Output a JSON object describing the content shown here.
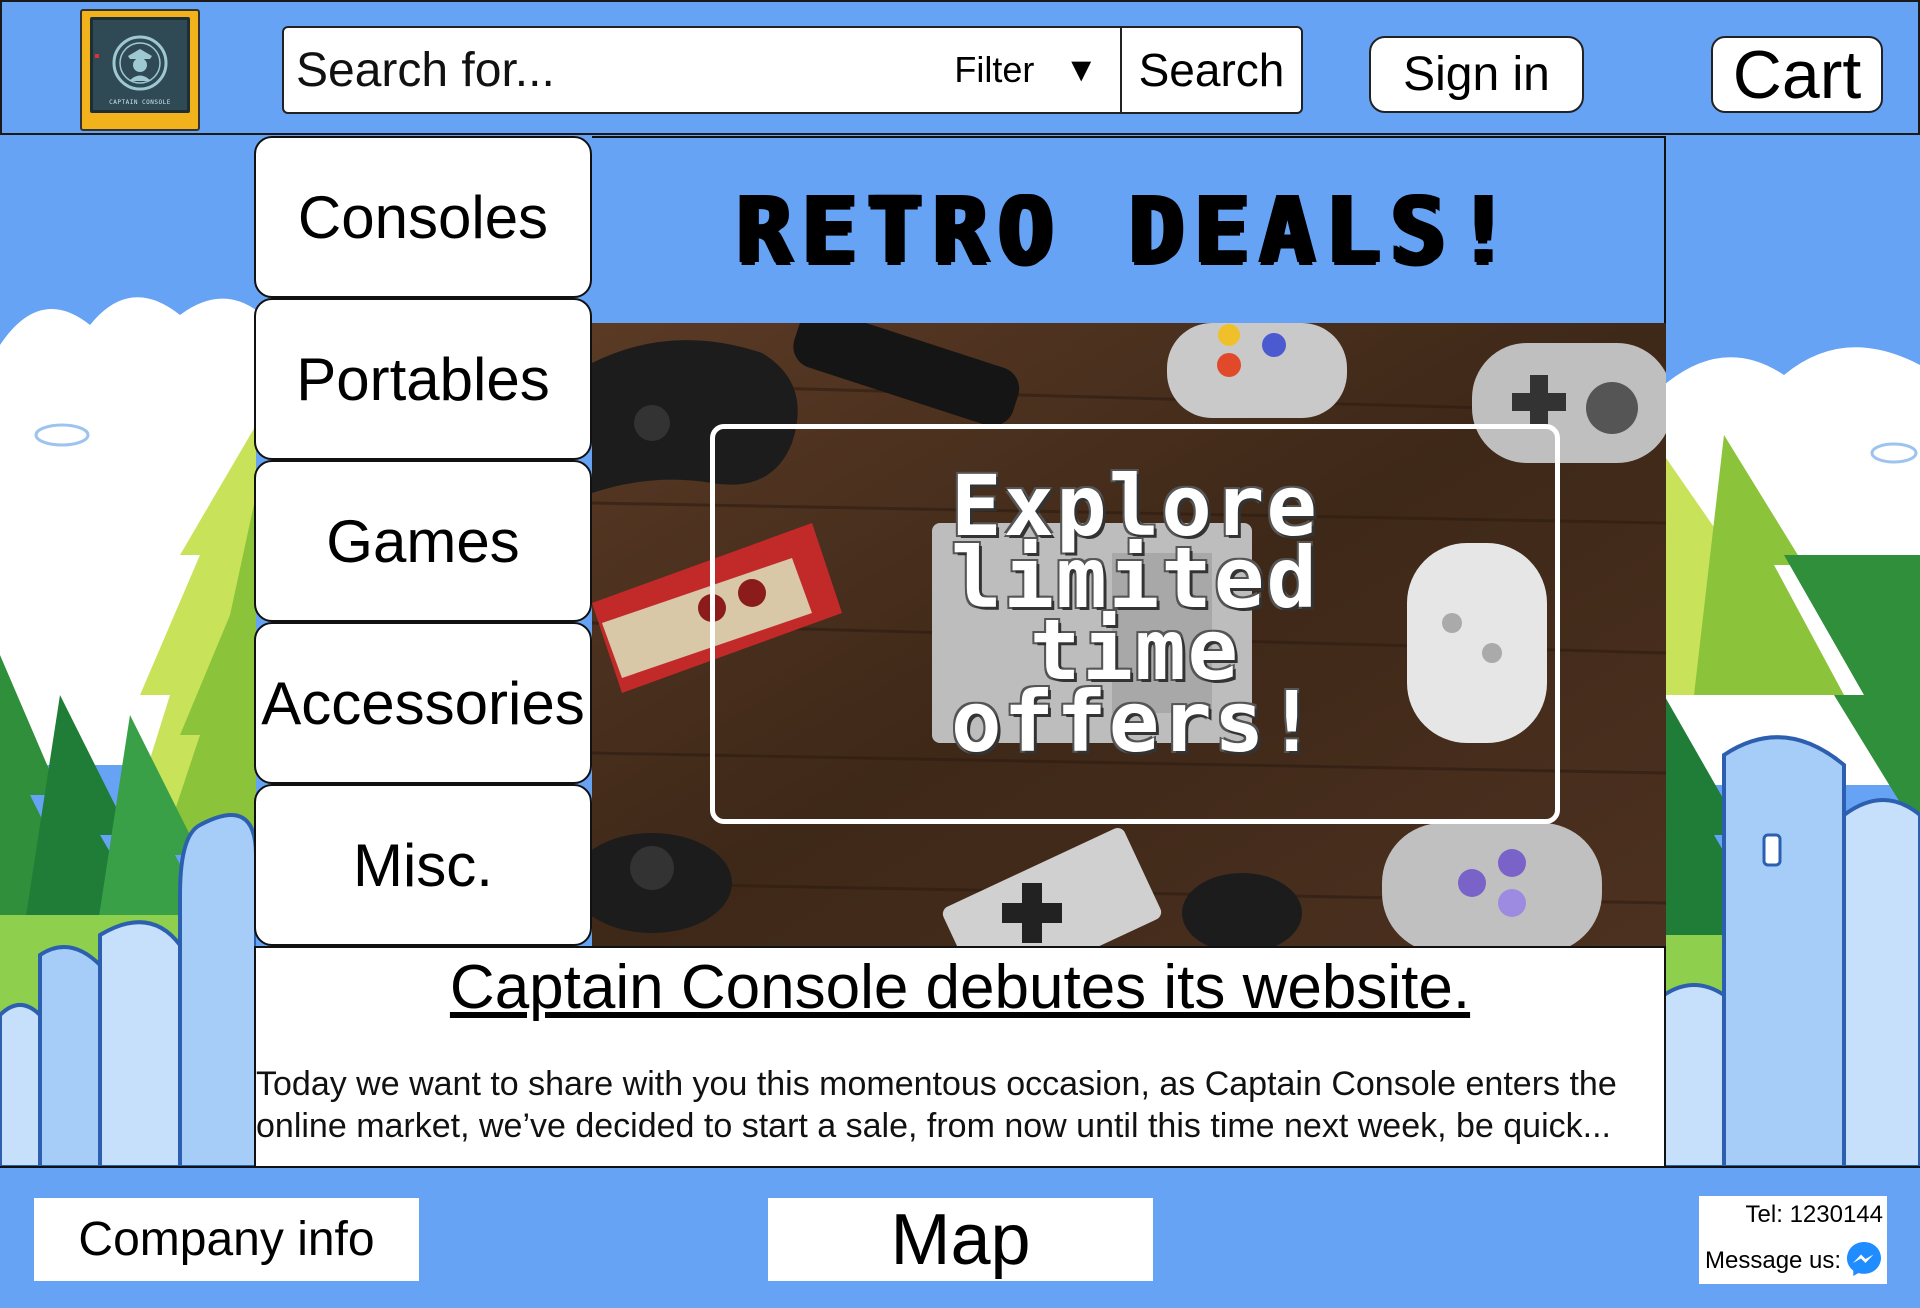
{
  "header": {
    "logo_caption": "CAPTAIN CONSOLE",
    "search_placeholder": "Search for...",
    "filter_label": "Filter",
    "search_label": "Search",
    "signin_label": "Sign in",
    "cart_label": "Cart"
  },
  "sidebar": {
    "items": [
      {
        "label": "Consoles"
      },
      {
        "label": "Portables"
      },
      {
        "label": "Games"
      },
      {
        "label": "Accessories"
      },
      {
        "label": "Misc."
      }
    ]
  },
  "banner": {
    "title": "RETRO DEALS!",
    "offer_text": "Explore limited time offers!"
  },
  "article": {
    "title": "Captain Console debutes its website.",
    "body": "Today we want to share with you this momentous occasion, as Captain Console enters the online market, we’ve decided to start a sale, from now until this time next week, be quick..."
  },
  "footer": {
    "company_label": "Company info",
    "map_label": "Map",
    "tel": "Tel: 1230144",
    "message_label": "Message us:"
  },
  "icons": {
    "filter_caret": "▼",
    "messenger": "messenger-icon"
  },
  "colors": {
    "background": "#66a3f5",
    "logo_frame": "#f2b21c",
    "messenger": "#1f8cff"
  }
}
